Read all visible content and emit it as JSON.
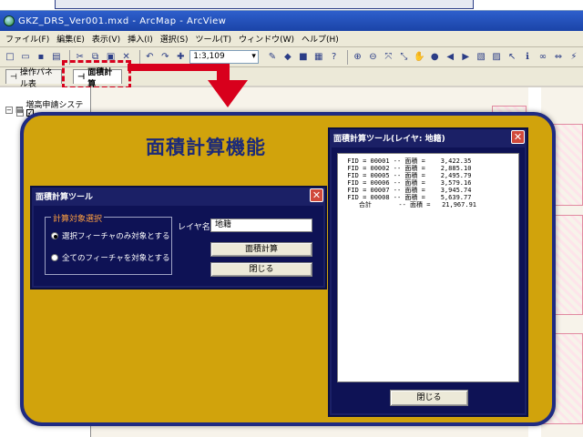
{
  "window": {
    "title": "GKZ_DRS_Ver001.mxd - ArcMap - ArcView"
  },
  "menu": {
    "items": [
      "ファイル(F)",
      "編集(E)",
      "表示(V)",
      "挿入(I)",
      "選択(S)",
      "ツール(T)",
      "ウィンドウ(W)",
      "ヘルプ(H)"
    ]
  },
  "toolbar": {
    "scale_value": "1:3,109"
  },
  "tabs": {
    "panel_label": "操作パネル表",
    "area_label": "面積計算"
  },
  "tree": {
    "root_label": "増高申請システム"
  },
  "overlay": {
    "title": "面積計算機能"
  },
  "tool_window": {
    "title": "面積計算ツール",
    "group_label": "計算対象選択",
    "radio_selected_label": "選択フィーチャのみ対象とする",
    "radio_all_label": "全てのフィーチャを対象とする",
    "layer_label": "レイヤ名",
    "layer_value": "地籍",
    "calc_button": "面積計算",
    "close_button": "閉じる"
  },
  "result_window": {
    "title": "面積計算ツール(レイヤ: 地籍)",
    "rows": [
      {
        "fid": "00001",
        "area": "3,422.35"
      },
      {
        "fid": "00002",
        "area": "2,885.10"
      },
      {
        "fid": "00005",
        "area": "2,495.79"
      },
      {
        "fid": "00006",
        "area": "3,579.16"
      },
      {
        "fid": "00007",
        "area": "3,945.74"
      },
      {
        "fid": "00008",
        "area": "5,639.77"
      }
    ],
    "total_label": "合計",
    "total_area": "21,967.91",
    "close_button": "閉じる"
  },
  "colors": {
    "overlay_bg": "#d1a30c",
    "overlay_border": "#1f2b82",
    "dialog_bg": "#1b2066",
    "highlight_red": "#d8001c"
  }
}
